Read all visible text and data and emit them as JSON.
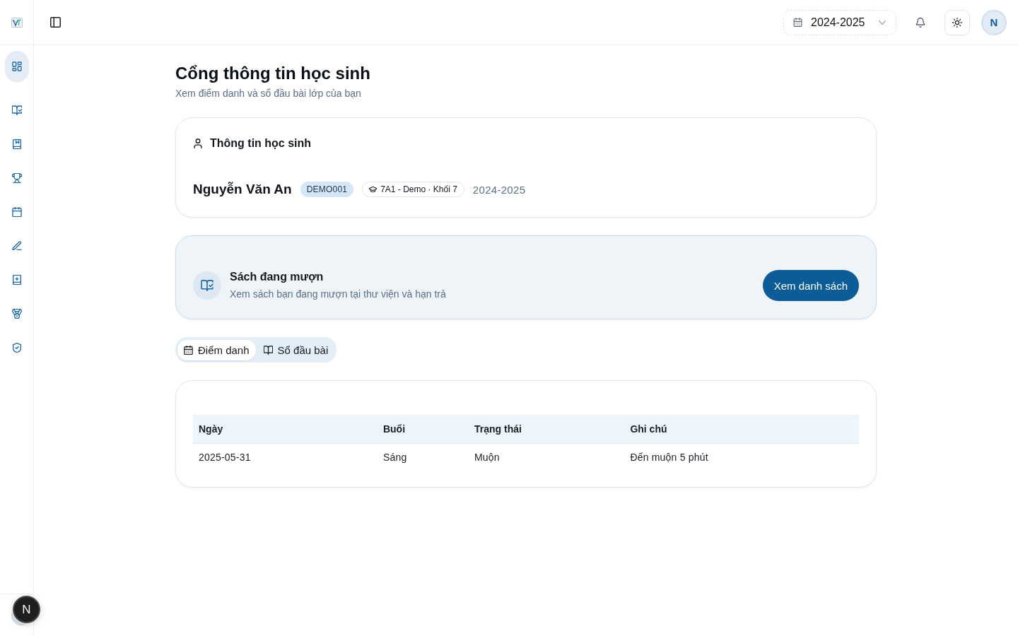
{
  "sidebar": {
    "items": [
      {
        "selected": true
      },
      {
        "selected": false
      },
      {
        "selected": false
      },
      {
        "selected": false
      },
      {
        "selected": false
      },
      {
        "selected": false
      },
      {
        "selected": false
      },
      {
        "selected": false
      },
      {
        "selected": false
      }
    ]
  },
  "header": {
    "year_select": {
      "value": "2024-2025"
    },
    "avatar": {
      "initial": "N"
    }
  },
  "page": {
    "title": "Cổng thông tin học sinh",
    "subtitle": "Xem điểm danh và sổ đầu bài lớp của bạn"
  },
  "student_card": {
    "heading": "Thông tin học sinh",
    "name": "Nguyễn Văn An",
    "code": "DEMO001",
    "class": "7A1 - Demo · Khối 7",
    "school_year": "2024-2025"
  },
  "borrow_card": {
    "title": "Sách đang mượn",
    "description": "Xem sách bạn đang mượn tại thư viện và hạn trả",
    "button": "Xem danh sách"
  },
  "tabs": [
    {
      "label": "Điểm danh",
      "selected": true
    },
    {
      "label": "Sổ đầu bài",
      "selected": false
    }
  ],
  "attendance_table": {
    "columns": [
      "Ngày",
      "Buổi",
      "Trạng thái",
      "Ghi chú"
    ],
    "rows": [
      [
        "2025-05-31",
        "Sáng",
        "Muộn",
        "Đến muộn 5 phút"
      ]
    ]
  },
  "dev_tools_button": {
    "label": "N"
  }
}
